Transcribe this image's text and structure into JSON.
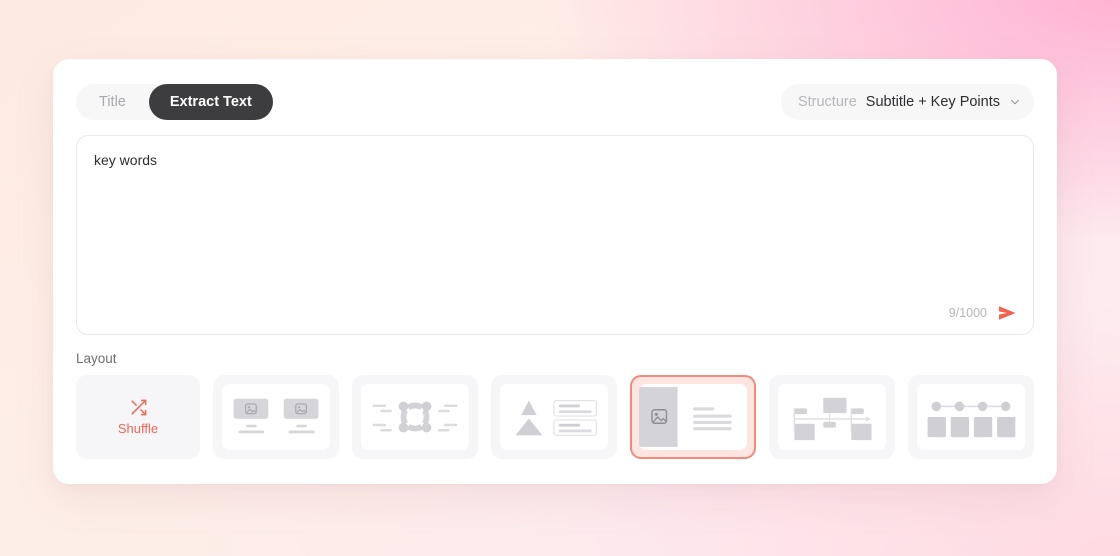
{
  "tabs": [
    {
      "label": "Title",
      "active": false,
      "name": "tab-title"
    },
    {
      "label": "Extract Text",
      "active": true,
      "name": "tab-extract-text"
    }
  ],
  "structure": {
    "label": "Structure",
    "value": "Subtitle + Key Points",
    "chevron_icon": "chevron-down-icon"
  },
  "editor": {
    "value": "key words",
    "placeholder": "key words",
    "counter": "9/1000",
    "send_icon": "send-arrow-icon"
  },
  "layout": {
    "title": "Layout",
    "shuffle": {
      "label": "Shuffle",
      "icon": "shuffle-icon",
      "color": "#f26655"
    },
    "options": [
      {
        "name": "layout-two-image-cards",
        "selected": false
      },
      {
        "name": "layout-radial-diagram",
        "selected": false
      },
      {
        "name": "layout-pyramid-list",
        "selected": false
      },
      {
        "name": "layout-image-left-text-right",
        "selected": true
      },
      {
        "name": "layout-timeline-flow",
        "selected": false
      },
      {
        "name": "layout-milestone-bars",
        "selected": false
      }
    ]
  },
  "colors": {
    "accent": "#f26655",
    "selected_border": "#f4897c",
    "selected_bg": "#fde6e2",
    "tab_active_bg": "#3d3d3f",
    "panel_bg": "#ffffff",
    "muted_text": "#b4b4b9",
    "placeholder_gray": "#d4d4d9"
  }
}
